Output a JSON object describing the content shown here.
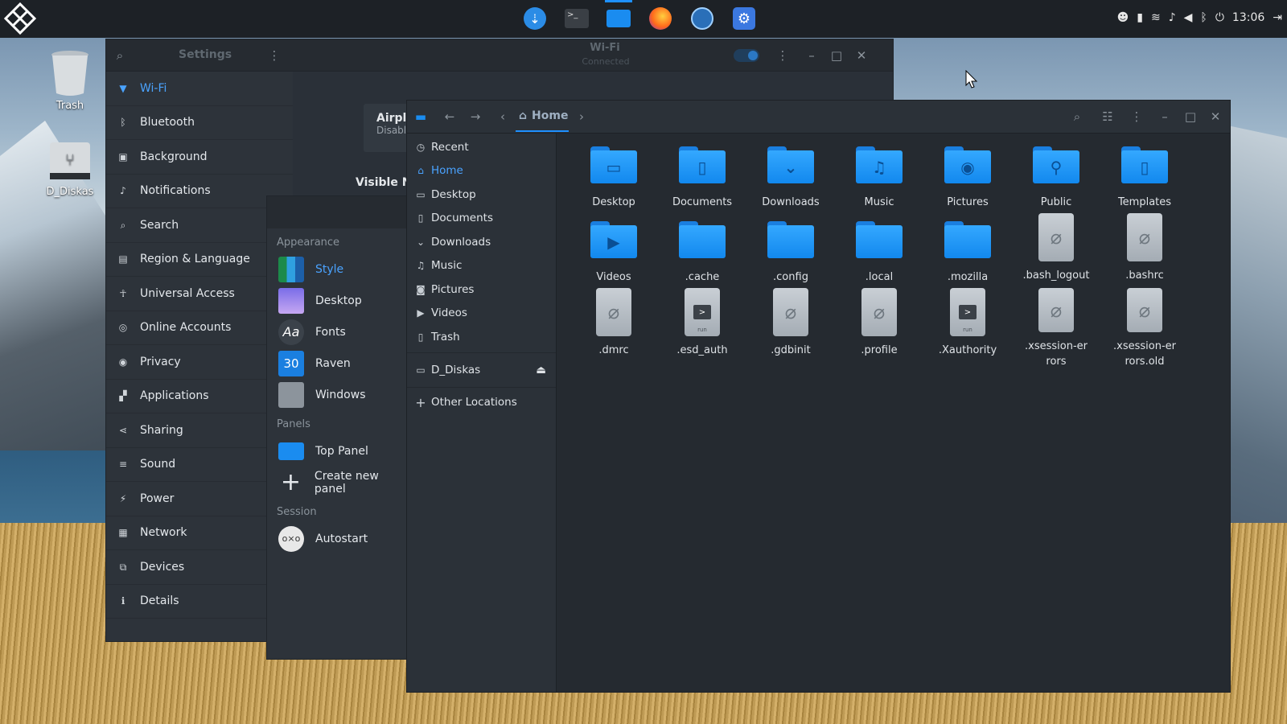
{
  "panel": {
    "clock": "13:06",
    "dock": [
      "downloader",
      "terminal",
      "files",
      "firefox",
      "settings-app",
      "tweaks"
    ]
  },
  "desktop": {
    "trash_label": "Trash",
    "drive_label": "D_Diskas"
  },
  "settings": {
    "title": "Settings",
    "wifi_title": "Wi-Fi",
    "wifi_status": "Connected",
    "airplane_title": "Airplar",
    "airplane_sub": "Disables",
    "visible_networks": "Visible Ne",
    "sidebar": [
      {
        "label": "Wi-Fi",
        "icon": "wifi-icon"
      },
      {
        "label": "Bluetooth",
        "icon": "bluetooth-icon"
      },
      {
        "label": "Background",
        "icon": "background-icon"
      },
      {
        "label": "Notifications",
        "icon": "notifications-icon"
      },
      {
        "label": "Search",
        "icon": "search-icon"
      },
      {
        "label": "Region & Language",
        "icon": "region-icon"
      },
      {
        "label": "Universal Access",
        "icon": "accessibility-icon"
      },
      {
        "label": "Online Accounts",
        "icon": "accounts-icon"
      },
      {
        "label": "Privacy",
        "icon": "privacy-icon"
      },
      {
        "label": "Applications",
        "icon": "applications-icon"
      },
      {
        "label": "Sharing",
        "icon": "sharing-icon"
      },
      {
        "label": "Sound",
        "icon": "sound-icon"
      },
      {
        "label": "Power",
        "icon": "power-icon"
      },
      {
        "label": "Network",
        "icon": "network-icon"
      },
      {
        "label": "Devices",
        "icon": "devices-icon"
      },
      {
        "label": "Details",
        "icon": "details-icon"
      }
    ]
  },
  "tweaks": {
    "sections": {
      "appearance": "Appearance",
      "panels": "Panels",
      "session": "Session"
    },
    "appearance_items": [
      "Style",
      "Desktop",
      "Fonts",
      "Raven",
      "Windows"
    ],
    "raven_badge": "30",
    "fonts_badge": "Aa",
    "panels_items": [
      "Top Panel",
      "Create new panel"
    ],
    "session_items": [
      "Autostart"
    ]
  },
  "files": {
    "location": "Home",
    "places": [
      "Recent",
      "Home",
      "Desktop",
      "Documents",
      "Downloads",
      "Music",
      "Pictures",
      "Videos",
      "Trash"
    ],
    "devices": [
      "D_Diskas"
    ],
    "other": "Other Locations",
    "items": [
      {
        "name": "Desktop",
        "kind": "folder",
        "glyph": "▭"
      },
      {
        "name": "Documents",
        "kind": "folder",
        "glyph": "▯"
      },
      {
        "name": "Downloads",
        "kind": "folder",
        "glyph": "⌄"
      },
      {
        "name": "Music",
        "kind": "folder",
        "glyph": "♫"
      },
      {
        "name": "Pictures",
        "kind": "folder",
        "glyph": "◉"
      },
      {
        "name": "Public",
        "kind": "folder",
        "glyph": "⚲"
      },
      {
        "name": "Templates",
        "kind": "folder",
        "glyph": "▯"
      },
      {
        "name": "Videos",
        "kind": "folder",
        "glyph": "▶"
      },
      {
        "name": ".cache",
        "kind": "folder",
        "glyph": ""
      },
      {
        "name": ".config",
        "kind": "folder",
        "glyph": ""
      },
      {
        "name": ".local",
        "kind": "folder",
        "glyph": ""
      },
      {
        "name": ".mozilla",
        "kind": "folder",
        "glyph": ""
      },
      {
        "name": ".bash_logout",
        "kind": "doc",
        "glyph": "⌇"
      },
      {
        "name": ".bashrc",
        "kind": "doc",
        "glyph": "⌇"
      },
      {
        "name": ".dmrc",
        "kind": "doc",
        "glyph": "⌇"
      },
      {
        "name": ".esd_auth",
        "kind": "run",
        "glyph": ">"
      },
      {
        "name": ".gdbinit",
        "kind": "doc",
        "glyph": "⌇"
      },
      {
        "name": ".profile",
        "kind": "doc",
        "glyph": "⌇"
      },
      {
        "name": ".Xauthority",
        "kind": "run",
        "glyph": ">"
      },
      {
        "name": ".xsession-errors",
        "kind": "doc",
        "glyph": "⌇"
      },
      {
        "name": ".xsession-errors.old",
        "kind": "doc",
        "glyph": "⌇"
      }
    ],
    "run_label": "run"
  },
  "colors": {
    "accent": "#1e90ff",
    "folder": "#1a8cf0",
    "panel": "#1d2126"
  }
}
